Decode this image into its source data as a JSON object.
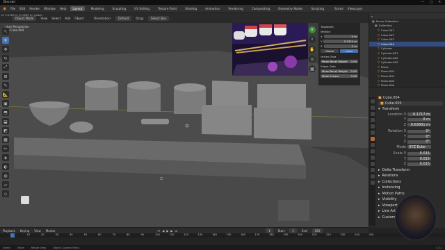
{
  "app": {
    "title": "Blender",
    "window_controls": [
      "—",
      "□",
      "✕"
    ]
  },
  "menu": [
    "File",
    "Edit",
    "Render",
    "Window",
    "Help"
  ],
  "workspaces": [
    "Layout",
    "Modeling",
    "Sculpting",
    "UV Editing",
    "Texture Paint",
    "Shading",
    "Animation",
    "Rendering",
    "Compositing",
    "Geometry Nodes",
    "Scripting"
  ],
  "scene": {
    "scene_label": "Scene",
    "view_layer_label": "ViewLayer"
  },
  "viewport": {
    "mode": "Object Mode",
    "orientation_label": "Orientation:",
    "orientation_value": "Default",
    "drag_label": "Drag:",
    "drag_value": "Select Box",
    "buttons": [
      "View",
      "Select",
      "Add",
      "Object"
    ],
    "info_line1": "User Perspective",
    "info_line2": "(1) Cube.004",
    "stats": "D: 2.0369 m (0.1669 m) global"
  },
  "npanel": {
    "header": "Transform",
    "median": "Median:",
    "x": "0 m",
    "y": "0.2324 m",
    "z": "0 m",
    "global": "Global",
    "local": "Local",
    "vcrease_hdr": "Vertex Data",
    "mean_bevel": "Mean Bevel Weight",
    "mean_bevel_v": "0.00",
    "edges_hdr": "Edges Data",
    "mean_bevel2": "Mean Bevel Weight",
    "mean_bevel2_v": "0.00",
    "mean_crease": "Mean Crease",
    "mean_crease_v": "0.00"
  },
  "outliner": {
    "items": [
      "Scene Collection",
      "Collection",
      "Cube.001",
      "Cube.002",
      "Cube.003",
      "Cube.004",
      "Cylinder",
      "Cylinder.001",
      "Cylinder.002",
      "Cylinder.003",
      "Plane",
      "Plane.001",
      "Plane.002",
      "Plane.003",
      "Plane.004",
      "Plane.005"
    ],
    "selected_index": 5
  },
  "properties": {
    "object": "Cube.004",
    "object_name": "Cube.004",
    "transform": "Transform",
    "location_x": "0.1717 m",
    "location_y": "0 m",
    "location_z": "0.63801 m",
    "rotation_x": "0°",
    "rotation_y": "0°",
    "rotation_z": "0°",
    "mode": "XYZ Euler",
    "scale_x": "0.015",
    "scale_y": "0.015",
    "scale_z": "0.015",
    "sections": [
      "Delta Transform",
      "Relations",
      "Collections",
      "Instancing",
      "Motion Paths",
      "Visibility",
      "Viewport Display",
      "Line Art",
      "Custom Properties"
    ]
  },
  "timeline": {
    "menus": [
      "Playback",
      "Keying",
      "View",
      "Marker"
    ],
    "frame": "1",
    "start_label": "Start",
    "start": "1",
    "end_label": "End",
    "end": "250",
    "ticks": [
      "0",
      "10",
      "20",
      "30",
      "40",
      "50",
      "60",
      "70",
      "80",
      "90",
      "100",
      "110",
      "120",
      "130",
      "140",
      "150",
      "160",
      "170",
      "180",
      "190",
      "200",
      "210",
      "220",
      "230",
      "240",
      "250"
    ]
  },
  "status": {
    "items": [
      "Select",
      "Move",
      "Rotate View",
      "Object Context Menu"
    ],
    "version": "3.3.1"
  },
  "axis_labels": {
    "labels_x": "X",
    "labels_y": "Y",
    "labels_z": "Z"
  }
}
